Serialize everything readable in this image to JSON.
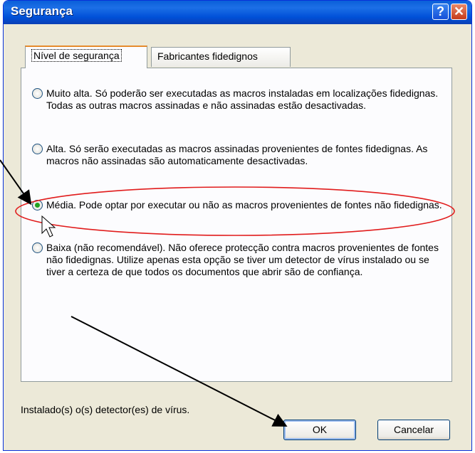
{
  "window": {
    "title": "Segurança",
    "help_glyph": "?",
    "close_glyph": "✕"
  },
  "tabs": [
    {
      "label": "Nível de segurança"
    },
    {
      "label": "Fabricantes fidedignos"
    }
  ],
  "options": [
    {
      "text": "Muito alta. Só poderão ser executadas as macros instaladas em localizações fidedignas. Todas as outras macros assinadas e não assinadas estão desactivadas.",
      "selected": false
    },
    {
      "text": "Alta. Só serão executadas as macros assinadas provenientes de fontes fidedignas. As macros não assinadas são automaticamente desactivadas.",
      "selected": false
    },
    {
      "text": "Média. Pode optar por executar ou não as macros provenientes de fontes não fidedignas.",
      "selected": true
    },
    {
      "text": "Baixa (não recomendável). Não oferece protecção contra macros provenientes de fontes não fidedignas. Utilize apenas esta opção se tiver um detector de vírus instalado ou se tiver a certeza de que todos os documentos que abrir são de confiança.",
      "selected": false
    }
  ],
  "footer": {
    "status": "Instalado(s) o(s) detector(es) de vírus."
  },
  "buttons": {
    "ok": "OK",
    "cancel": "Cancelar"
  },
  "colors": {
    "titlebar": "#0a5fd9",
    "annotation": "#e11c1c",
    "radio_checked": "#21a121"
  }
}
